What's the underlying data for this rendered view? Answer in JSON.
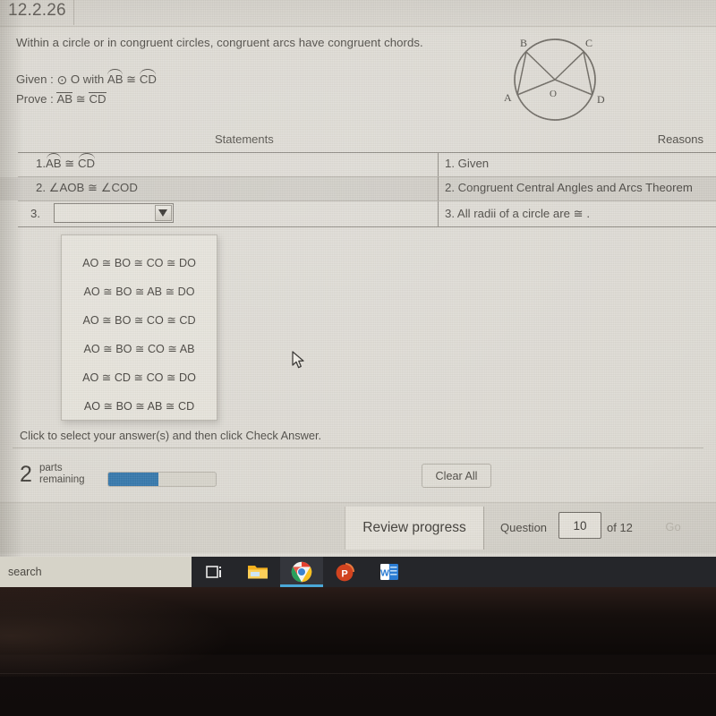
{
  "tab": {
    "label": "12.2.26"
  },
  "lesson": {
    "prompt": "Within a circle or in congruent circles, congruent arcs have congruent chords.",
    "given_prefix": "Given :",
    "given_circle": "⊙",
    "given_text_a": "O with",
    "given_arc_1": "AB",
    "given_cong_1": "≅",
    "given_arc_2": "CD",
    "prove_prefix": "Prove :",
    "prove_seg_1": "AB",
    "prove_cong": "≅",
    "prove_seg_2": "CD"
  },
  "figure": {
    "center_label": "O",
    "point_a": "A",
    "point_b": "B",
    "point_c": "C",
    "point_d": "D"
  },
  "table": {
    "header_statements": "Statements",
    "header_reasons": "Reasons",
    "rows": [
      {
        "num": "1.",
        "statement_arc_1": "AB",
        "cong": "≅",
        "statement_arc_2": "CD",
        "reason": "1. Given"
      },
      {
        "num": "2.",
        "statement": "2. ∠AOB ≅ ∠COD",
        "reason": "2. Congruent Central Angles and Arcs Theorem"
      },
      {
        "num": "3.",
        "statement": "",
        "reason": "3. All radii of a circle are ≅ ."
      }
    ]
  },
  "dropdown": {
    "options": [
      "AO ≅ BO ≅ CO ≅ DO",
      "AO ≅ BO ≅ AB ≅ DO",
      "AO ≅ BO ≅ CO ≅ CD",
      "AO ≅ BO ≅ CO ≅ AB",
      "AO ≅ CD ≅ CO ≅ DO",
      "AO ≅ BO ≅ AB ≅ CD"
    ]
  },
  "instruction": "Click to select your answer(s) and then click Check Answer.",
  "progress": {
    "count": "2",
    "label_line1": "parts",
    "label_line2": "remaining",
    "percent": 47,
    "fill_color": "#3276ab",
    "clear_all": "Clear All"
  },
  "footer": {
    "review": "Review progress",
    "question_label": "Question",
    "question_value": "10",
    "of_label": "of 12",
    "go": "Go"
  },
  "taskbar": {
    "search_placeholder": "search",
    "items": [
      {
        "name": "task-view-icon"
      },
      {
        "name": "file-explorer-icon"
      },
      {
        "name": "chrome-icon"
      },
      {
        "name": "powerpoint-icon"
      },
      {
        "name": "word-icon"
      }
    ]
  }
}
